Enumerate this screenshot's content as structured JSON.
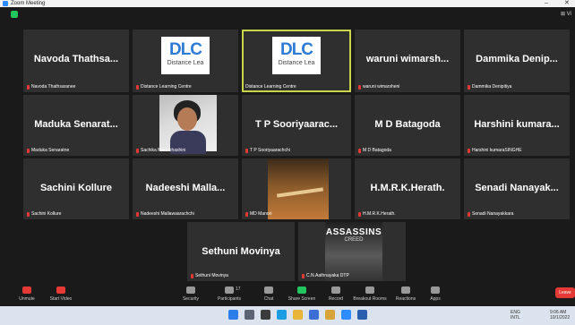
{
  "window": {
    "title": "Zoom Meeting",
    "minimize": "–",
    "close": "✕"
  },
  "view": {
    "label": "⊞ Vi"
  },
  "participants": [
    {
      "name": "Navoda Thathsa...",
      "label": "Navoda Thathsaranee",
      "type": "name"
    },
    {
      "name": "",
      "label": "Distance Learning Centre",
      "type": "logo"
    },
    {
      "name": "",
      "label": "Distance Learning Centre",
      "type": "logo",
      "active": true
    },
    {
      "name": "waruni wimarsh...",
      "label": "waruni wimarsheni",
      "type": "name"
    },
    {
      "name": "Dammika Denip...",
      "label": "Dammika Denipitiya",
      "type": "name"
    },
    {
      "name": "Maduka Senarat...",
      "label": "Maduka Senaratne",
      "type": "name"
    },
    {
      "name": "",
      "label": "Sachika Madubhashini",
      "type": "photo"
    },
    {
      "name": "T P Sooriyaarac...",
      "label": "T P Sooriyaarachchi",
      "type": "name"
    },
    {
      "name": "M D Batagoda",
      "label": "M D Batagoda",
      "type": "name"
    },
    {
      "name": "Harshini kumara...",
      "label": "Harshini kumaraSINGHE",
      "type": "name"
    },
    {
      "name": "Sachini Kollure",
      "label": "Sachini Kollure",
      "type": "name"
    },
    {
      "name": "Nadeeshi Malla...",
      "label": "Nadeeshi Mallawaarachchi",
      "type": "name"
    },
    {
      "name": "",
      "label": "MD Manori",
      "type": "desert"
    },
    {
      "name": "H.M.R.K.Herath.",
      "label": "H.M.R.K.Herath.",
      "type": "name"
    },
    {
      "name": "Senadi Nanayak...",
      "label": "Senadi Nanayakkara",
      "type": "name"
    },
    {
      "name": "Sethuni Movinya",
      "label": "Sethuni Movinya",
      "type": "name"
    },
    {
      "name": "",
      "label": "C.N.Aathnayaka DTP",
      "type": "poster"
    }
  ],
  "logo": {
    "big": "DLC",
    "small": "Distance Lea"
  },
  "poster": {
    "line1": "ASSASSINS",
    "line2": "CREED"
  },
  "toolbar": {
    "unmute": "Unmute",
    "start_video": "Start Video",
    "security": "Security",
    "participants": "Participants",
    "participants_count": "17",
    "chat": "Chat",
    "share_screen": "Share Screen",
    "record": "Record",
    "breakout_rooms": "Breakout Rooms",
    "reactions": "Reactions",
    "apps": "Apps",
    "leave": "Leave"
  },
  "tray": {
    "lang": "ENG",
    "region": "INTL",
    "time": "9:06 AM",
    "date": "10/1/2022"
  },
  "colors": {
    "tile": "#2f2f2f",
    "active_border": "#c9d34b",
    "leave": "#e53935",
    "dlc_blue": "#2e7bd6"
  }
}
